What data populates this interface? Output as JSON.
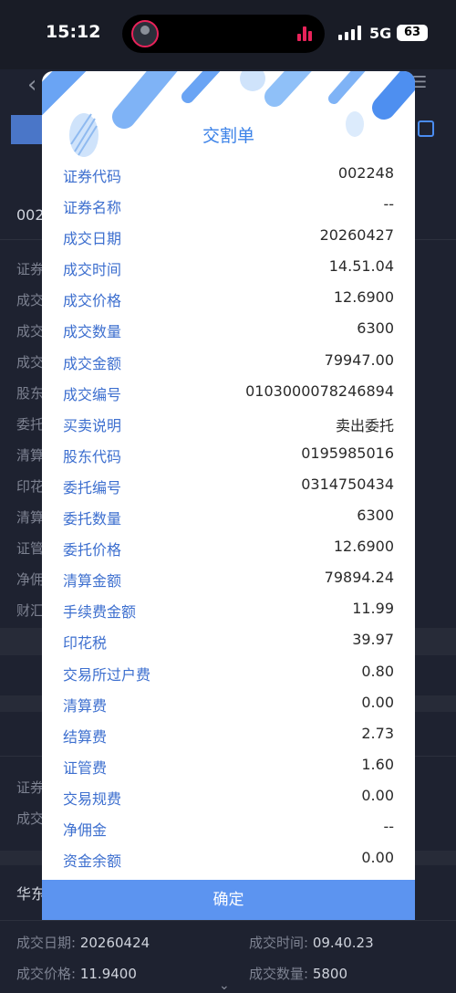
{
  "status_bar": {
    "time": "15:12",
    "network": "5G",
    "battery": "63"
  },
  "background": {
    "code_prefix": "002",
    "labels": [
      "证券",
      "成交",
      "成交",
      "成交",
      "股东",
      "委托",
      "清算",
      "印花",
      "清算",
      "证管",
      "净佣",
      "财汇"
    ],
    "labels2": [
      "证券",
      "成交"
    ],
    "broker_prefix": "华东",
    "bottom": {
      "date_label": "成交日期:",
      "date": "20260424",
      "time_label": "成交时间:",
      "time": "09.40.23",
      "price_label": "成交价格:",
      "price": "11.9400",
      "qty_label": "成交数量:",
      "qty": "5800"
    }
  },
  "modal": {
    "title": "交割单",
    "rows": [
      {
        "label": "证券代码",
        "value": "002248"
      },
      {
        "label": "证券名称",
        "value": "--"
      },
      {
        "label": "成交日期",
        "value": "20260427"
      },
      {
        "label": "成交时间",
        "value": "14.51.04"
      },
      {
        "label": "成交价格",
        "value": "12.6900"
      },
      {
        "label": "成交数量",
        "value": "6300"
      },
      {
        "label": "成交金额",
        "value": "79947.00"
      },
      {
        "label": "成交编号",
        "value": "0103000078246894"
      },
      {
        "label": "买卖说明",
        "value": "卖出委托"
      },
      {
        "label": "股东代码",
        "value": "0195985016"
      },
      {
        "label": "委托编号",
        "value": "0314750434"
      },
      {
        "label": "委托数量",
        "value": "6300"
      },
      {
        "label": "委托价格",
        "value": "12.6900"
      },
      {
        "label": "清算金额",
        "value": "79894.24"
      },
      {
        "label": "手续费金额",
        "value": "11.99"
      },
      {
        "label": "印花税",
        "value": "39.97"
      },
      {
        "label": "交易所过户费",
        "value": "0.80"
      },
      {
        "label": "清算费",
        "value": "0.00"
      },
      {
        "label": "结算费",
        "value": "2.73"
      },
      {
        "label": "证管费",
        "value": "1.60"
      },
      {
        "label": "交易规费",
        "value": "0.00"
      },
      {
        "label": "净佣金",
        "value": "--"
      },
      {
        "label": "资金余额",
        "value": "0.00"
      }
    ],
    "confirm_label": "确定"
  },
  "colors": {
    "accent": "#5c94f0",
    "label_blue": "#3d6fcf",
    "background": "#1e2230"
  }
}
